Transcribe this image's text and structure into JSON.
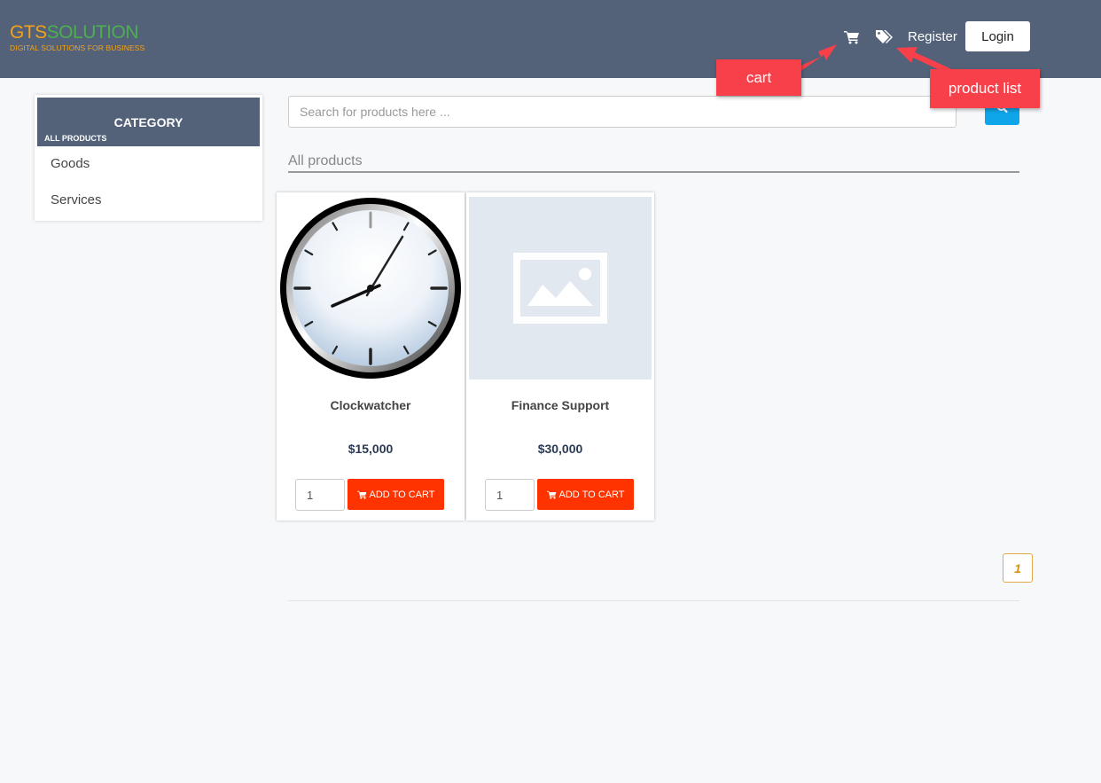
{
  "header": {
    "logo_main_1": "GTS",
    "logo_main_2": "SOLUTION",
    "logo_sub": "DIGITAL SOLUTIONS FOR BUSINESS",
    "register_label": "Register",
    "login_label": "Login"
  },
  "sidebar": {
    "title": "CATEGORY",
    "subtitle": "ALL PRODUCTS",
    "items": [
      {
        "label": "Goods"
      },
      {
        "label": "Services"
      }
    ]
  },
  "search": {
    "placeholder": "Search for products here ..."
  },
  "main": {
    "section_title": "All products",
    "products": [
      {
        "name": "Clockwatcher",
        "price": "$15,000",
        "qty": "1",
        "button_label": "ADD TO CART",
        "image": "clock-image"
      },
      {
        "name": "Finance Support",
        "price": "$30,000",
        "qty": "1",
        "button_label": "ADD TO CART",
        "image": "placeholder-image"
      }
    ]
  },
  "pagination": {
    "current_page": "1"
  },
  "annotations": {
    "cart": "cart",
    "product_list": "product list"
  },
  "colors": {
    "header_bg": "#536179",
    "add_to_cart": "#ff3300",
    "search_button": "#0ea5e9",
    "callout": "#f8404a"
  }
}
